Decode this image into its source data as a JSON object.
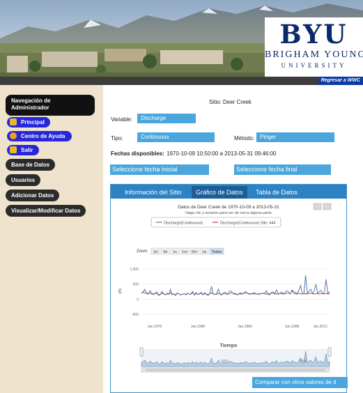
{
  "header": {
    "logo_mark": "BYU",
    "logo_name": "BRIGHAM YOUNG",
    "logo_university": "UNIVERSITY",
    "return_link": "Regresar a WWC"
  },
  "sidebar": {
    "title": "Navegación de Administrador",
    "items": [
      {
        "label": "Principal",
        "icon": "home-icon"
      },
      {
        "label": "Centro de Ayuda",
        "icon": "help-icon"
      },
      {
        "label": "Salir",
        "icon": "lock-icon"
      },
      {
        "label": "Base de Datos"
      },
      {
        "label": "Usuarios"
      },
      {
        "label": "Adicionar Datos"
      },
      {
        "label": "Visualizar/Modificar Datos"
      }
    ]
  },
  "form": {
    "site_label": "Sitio:",
    "site_value": "Deer Creek",
    "variable_label": "Variable:",
    "variable_value": "Discharge",
    "type_label": "Tipo:",
    "type_value": "Continuous",
    "method_label": "Método:",
    "method_value": "Pinger",
    "dates_label": "Fechas disponibles:",
    "dates_value": "1970-10-09 10:50:00 a 2013-05-31 09:46:00",
    "start_date_button": "Seleccione fecha inicial",
    "end_date_button": "Seleccione fecha final"
  },
  "tabs": [
    "Información del Sitio",
    "Gráfico de Datos",
    "Tabla de Datos"
  ],
  "active_tab": 1,
  "zoom": {
    "label": "Zoom",
    "options": [
      "1d",
      "3d",
      "1s",
      "1m",
      "6m",
      "1a",
      "Todos"
    ],
    "selected": "Todos"
  },
  "compare_button": "Comparar con otros valores de d",
  "colors": {
    "accent_blue": "#4aa6dc",
    "tab_blue": "#2d82c4",
    "nav_blue": "#2727d9",
    "sidebar_bg": "#efe3cd",
    "series_1": "#4a6fa5",
    "series_2": "#c0392b"
  },
  "chart_data": {
    "type": "line",
    "title": "Datos de Deer Creek de 1970-10-09 a 2013-05-31",
    "subtitle": "Haga clic y arrastre para ver de cerca alguna parte",
    "xlabel": "Tiempo",
    "ylabel": "cfs",
    "ylim": [
      -500,
      1000
    ],
    "yticks": [
      "1,000",
      "500",
      "0",
      "-500"
    ],
    "xticks": [
      "Jan.1976",
      "Jan.1980",
      "Jan.1984",
      "Jan.1988",
      "Jan.2012"
    ],
    "navigator_labels": [
      "1975",
      "2000"
    ],
    "legend_position": "top",
    "series": [
      {
        "name": "Discharge(Continuous)",
        "values": [
          210,
          240,
          330,
          190,
          160,
          280,
          210,
          150,
          190,
          240,
          120,
          150,
          260,
          180,
          140,
          200,
          160,
          320,
          150,
          180,
          120,
          210,
          170,
          140,
          160,
          190,
          140,
          200,
          160,
          180,
          260,
          130,
          230,
          150,
          190,
          230,
          140,
          220,
          160,
          120,
          200,
          420,
          170,
          150,
          190,
          330,
          160,
          140,
          210,
          240,
          160,
          220,
          280,
          230,
          160,
          200,
          140,
          180,
          210,
          160,
          220,
          250,
          200,
          160,
          190,
          170,
          220,
          160,
          180,
          150,
          200,
          180,
          190,
          280,
          160,
          140,
          220,
          240,
          190,
          310,
          160,
          200,
          240,
          170,
          230,
          280,
          240,
          170,
          300,
          250,
          230,
          160,
          280,
          450,
          220,
          170,
          790,
          200,
          260,
          330,
          190,
          270,
          500,
          200,
          250,
          290,
          180,
          240,
          660,
          170,
          260
        ]
      },
      {
        "name": "Discharge(Continuous) Site: 444",
        "values": [
          200,
          230,
          210,
          180,
          190,
          210,
          160,
          170,
          200,
          190,
          150,
          160,
          200,
          170,
          150,
          170,
          160,
          210,
          150,
          170,
          150,
          200,
          170,
          150,
          160,
          180,
          160,
          190,
          160,
          170,
          200,
          150,
          180,
          160,
          170,
          190,
          160,
          180,
          170,
          150,
          180,
          210,
          170,
          160,
          170,
          190,
          170,
          160,
          190,
          180,
          160,
          170,
          190,
          220,
          180,
          170,
          160,
          170,
          180,
          170,
          190,
          200,
          200,
          180,
          170,
          190,
          180,
          170,
          180,
          170,
          190,
          200,
          180,
          170,
          170,
          180,
          200,
          190,
          170,
          180,
          170,
          190,
          180,
          170,
          180,
          200,
          190,
          180,
          280,
          190,
          170,
          200,
          190,
          180,
          170,
          190,
          180,
          170,
          200,
          190,
          180,
          170,
          190,
          180,
          170,
          190,
          180,
          170,
          190,
          180,
          170
        ]
      }
    ]
  }
}
